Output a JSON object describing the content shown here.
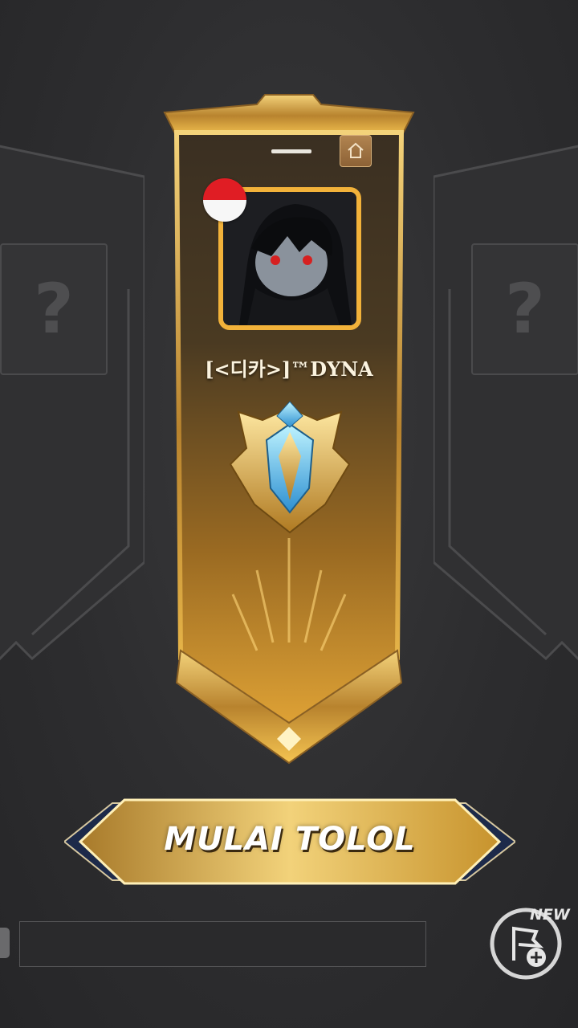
{
  "player": {
    "name": "[<디카>]™DYNA",
    "country_flag": "indonesia-flag",
    "avatar": "anime-character-avatar"
  },
  "rank": {
    "emblem": "mythic-rank-emblem"
  },
  "placeholders": {
    "left_symbol": "?",
    "right_symbol": "?"
  },
  "start_button": {
    "label": "MULAI TOLOL"
  },
  "corner": {
    "new_badge": "NEW"
  },
  "colors": {
    "gold": "#f2b23a",
    "flag_red": "#e01d24",
    "flag_white": "#f7f7f7",
    "background": "#2d2d2f"
  }
}
